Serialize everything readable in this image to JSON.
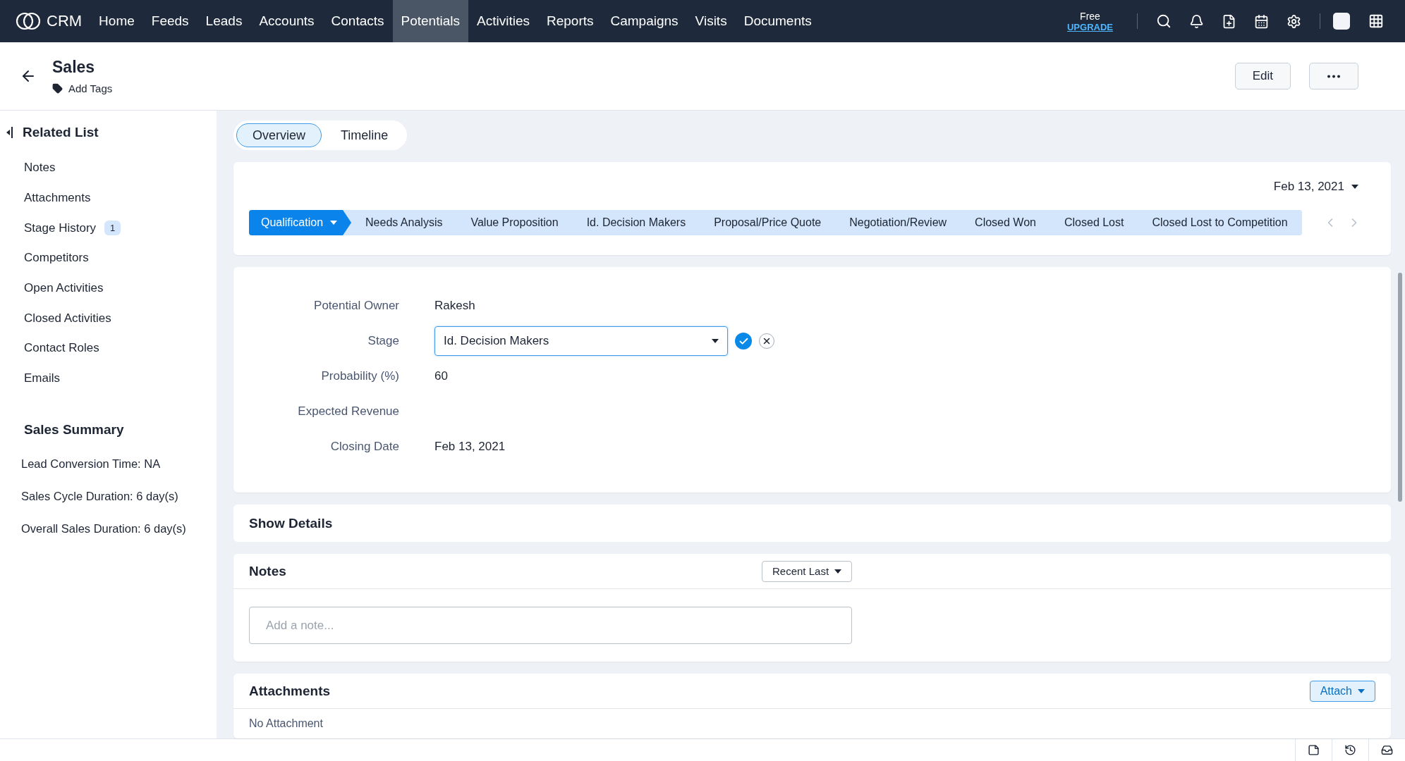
{
  "top_nav": {
    "logo": "CRM",
    "plan": "Free",
    "upgrade": "UPGRADE",
    "items": [
      {
        "label": "Home",
        "selected": false
      },
      {
        "label": "Feeds",
        "selected": false
      },
      {
        "label": "Leads",
        "selected": false
      },
      {
        "label": "Accounts",
        "selected": false
      },
      {
        "label": "Contacts",
        "selected": false
      },
      {
        "label": "Potentials",
        "selected": true
      },
      {
        "label": "Activities",
        "selected": false
      },
      {
        "label": "Reports",
        "selected": false
      },
      {
        "label": "Campaigns",
        "selected": false
      },
      {
        "label": "Visits",
        "selected": false
      },
      {
        "label": "Documents",
        "selected": false
      }
    ]
  },
  "header": {
    "title": "Sales",
    "add_tags": "Add Tags",
    "edit_button": "Edit"
  },
  "sidebar": {
    "title": "Related List",
    "items": [
      {
        "label": "Notes"
      },
      {
        "label": "Attachments"
      },
      {
        "label": "Stage History",
        "badge": "1"
      },
      {
        "label": "Competitors"
      },
      {
        "label": "Open Activities"
      },
      {
        "label": "Closed Activities"
      },
      {
        "label": "Contact Roles"
      },
      {
        "label": "Emails"
      }
    ],
    "summary_title": "Sales Summary",
    "summary": [
      "Lead Conversion Time: NA",
      "Sales Cycle Duration: 6 day(s)",
      "Overall Sales Duration: 6 day(s)"
    ]
  },
  "tabs": [
    {
      "label": "Overview",
      "selected": true
    },
    {
      "label": "Timeline",
      "selected": false
    }
  ],
  "stage_card": {
    "date": "Feb 13, 2021",
    "stages": [
      {
        "label": "Qualification",
        "selected": true
      },
      {
        "label": "Needs Analysis",
        "selected": false
      },
      {
        "label": "Value Proposition",
        "selected": false
      },
      {
        "label": "Id. Decision Makers",
        "selected": false
      },
      {
        "label": "Proposal/Price Quote",
        "selected": false
      },
      {
        "label": "Negotiation/Review",
        "selected": false
      },
      {
        "label": "Closed Won",
        "selected": false
      },
      {
        "label": "Closed Lost",
        "selected": false
      },
      {
        "label": "Closed Lost to Competition",
        "selected": false
      }
    ]
  },
  "fields": [
    {
      "label": "Potential Owner",
      "kind": "text",
      "value": "Rakesh"
    },
    {
      "label": "Stage",
      "kind": "select",
      "value": "Id. Decision Makers"
    },
    {
      "label": "Probability (%)",
      "kind": "text",
      "value": "60"
    },
    {
      "label": "Expected Revenue",
      "kind": "text"
    },
    {
      "label": "Closing Date",
      "kind": "text",
      "value": "Feb 13, 2021"
    }
  ],
  "show_details": "Show Details",
  "notes": {
    "title": "Notes",
    "sort": "Recent Last",
    "placeholder": "Add a note..."
  },
  "attachments": {
    "title": "Attachments",
    "button": "Attach",
    "empty": "No Attachment"
  }
}
